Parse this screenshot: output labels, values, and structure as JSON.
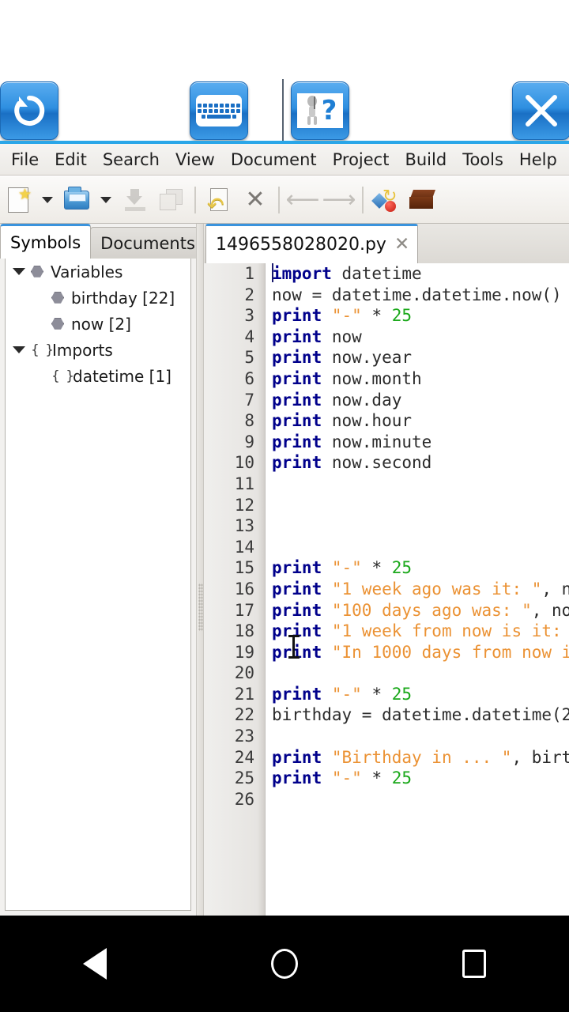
{
  "window": {
    "action_buttons": [
      {
        "name": "rotate-screen-button",
        "icon": "rotate-icon",
        "label": "Rotate"
      },
      {
        "name": "keyboard-toggle-button",
        "icon": "keyboard-icon",
        "label": "Keyboard"
      },
      {
        "name": "help-button",
        "icon": "help-question-icon",
        "label": "Help"
      },
      {
        "name": "close-button",
        "icon": "close-x-icon",
        "label": "Close"
      }
    ]
  },
  "menubar": {
    "items": [
      "File",
      "Edit",
      "Search",
      "View",
      "Document",
      "Project",
      "Build",
      "Tools",
      "Help"
    ]
  },
  "toolbar": {
    "items": [
      {
        "name": "new-document-button",
        "icon": "new-document-icon"
      },
      {
        "name": "new-document-dropdown",
        "icon": "chevron-down-icon"
      },
      {
        "name": "open-file-button",
        "icon": "open-folder-icon"
      },
      {
        "name": "open-file-dropdown",
        "icon": "chevron-down-icon"
      },
      {
        "name": "save-button",
        "icon": "save-icon"
      },
      {
        "name": "save-all-button",
        "icon": "save-all-icon"
      },
      {
        "name": "revert-button",
        "icon": "revert-document-icon"
      },
      {
        "name": "close-document-button",
        "icon": "close-x-icon"
      },
      {
        "name": "navigate-back-button",
        "icon": "arrow-left-icon"
      },
      {
        "name": "navigate-forward-button",
        "icon": "arrow-right-icon"
      },
      {
        "name": "compile-button",
        "icon": "compile-icon"
      },
      {
        "name": "build-button",
        "icon": "brick-build-icon"
      }
    ]
  },
  "sidebar": {
    "tabs": [
      {
        "label": "Symbols",
        "active": true
      },
      {
        "label": "Documents",
        "active": false
      }
    ],
    "tree": [
      {
        "label": "Variables",
        "level": 0,
        "expanded": true,
        "icon": "variable-hex-icon"
      },
      {
        "label": "birthday [22]",
        "level": 1,
        "expanded": null,
        "icon": "variable-hex-icon"
      },
      {
        "label": "now [2]",
        "level": 1,
        "expanded": null,
        "icon": "variable-hex-icon"
      },
      {
        "label": "Imports",
        "level": 0,
        "expanded": true,
        "icon": "import-brace-icon",
        "brace": "{ }"
      },
      {
        "label": "datetime [1]",
        "level": 1,
        "expanded": null,
        "icon": "import-brace-icon",
        "brace": "{ }"
      }
    ]
  },
  "editor": {
    "tab": {
      "filename": "1496558028020.py",
      "close_label": "✕"
    },
    "lines": [
      {
        "num": "1",
        "tokens": [
          {
            "t": "import",
            "c": "k"
          },
          {
            "t": " datetime",
            "c": "o"
          }
        ]
      },
      {
        "num": "2",
        "tokens": [
          {
            "t": "now = datetime.datetime.now()",
            "c": "o"
          }
        ]
      },
      {
        "num": "3",
        "tokens": [
          {
            "t": "print",
            "c": "k"
          },
          {
            "t": " ",
            "c": "o"
          },
          {
            "t": "\"-\"",
            "c": "s"
          },
          {
            "t": " * ",
            "c": "o"
          },
          {
            "t": "25",
            "c": "n"
          }
        ]
      },
      {
        "num": "4",
        "tokens": [
          {
            "t": "print",
            "c": "k"
          },
          {
            "t": " now",
            "c": "o"
          }
        ]
      },
      {
        "num": "5",
        "tokens": [
          {
            "t": "print",
            "c": "k"
          },
          {
            "t": " now.year",
            "c": "o"
          }
        ]
      },
      {
        "num": "6",
        "tokens": [
          {
            "t": "print",
            "c": "k"
          },
          {
            "t": " now.month",
            "c": "o"
          }
        ]
      },
      {
        "num": "7",
        "tokens": [
          {
            "t": "print",
            "c": "k"
          },
          {
            "t": " now.day",
            "c": "o"
          }
        ]
      },
      {
        "num": "8",
        "tokens": [
          {
            "t": "print",
            "c": "k"
          },
          {
            "t": " now.hour",
            "c": "o"
          }
        ]
      },
      {
        "num": "9",
        "tokens": [
          {
            "t": "print",
            "c": "k"
          },
          {
            "t": " now.minute",
            "c": "o"
          }
        ]
      },
      {
        "num": "10",
        "tokens": [
          {
            "t": "print",
            "c": "k"
          },
          {
            "t": " now.second",
            "c": "o"
          }
        ]
      },
      {
        "num": "11",
        "tokens": []
      },
      {
        "num": "12",
        "tokens": []
      },
      {
        "num": "13",
        "tokens": []
      },
      {
        "num": "14",
        "tokens": []
      },
      {
        "num": "15",
        "tokens": [
          {
            "t": "print",
            "c": "k"
          },
          {
            "t": " ",
            "c": "o"
          },
          {
            "t": "\"-\"",
            "c": "s"
          },
          {
            "t": " * ",
            "c": "o"
          },
          {
            "t": "25",
            "c": "n"
          }
        ]
      },
      {
        "num": "16",
        "tokens": [
          {
            "t": "print",
            "c": "k"
          },
          {
            "t": " ",
            "c": "o"
          },
          {
            "t": "\"1 week ago was it: \"",
            "c": "s"
          },
          {
            "t": ", no",
            "c": "o"
          }
        ]
      },
      {
        "num": "17",
        "tokens": [
          {
            "t": "print",
            "c": "k"
          },
          {
            "t": " ",
            "c": "o"
          },
          {
            "t": "\"100 days ago was: \"",
            "c": "s"
          },
          {
            "t": ", now",
            "c": "o"
          }
        ]
      },
      {
        "num": "18",
        "tokens": [
          {
            "t": "print",
            "c": "k"
          },
          {
            "t": " ",
            "c": "o"
          },
          {
            "t": "\"1 week from now is it: ",
            "c": "s"
          }
        ]
      },
      {
        "num": "19",
        "tokens": [
          {
            "t": "print",
            "c": "k"
          },
          {
            "t": " ",
            "c": "o"
          },
          {
            "t": "\"In 1000 days from now i",
            "c": "s"
          }
        ]
      },
      {
        "num": "20",
        "tokens": []
      },
      {
        "num": "21",
        "tokens": [
          {
            "t": "print",
            "c": "k"
          },
          {
            "t": " ",
            "c": "o"
          },
          {
            "t": "\"-\"",
            "c": "s"
          },
          {
            "t": " * ",
            "c": "o"
          },
          {
            "t": "25",
            "c": "n"
          }
        ]
      },
      {
        "num": "22",
        "tokens": [
          {
            "t": "birthday = datetime.datetime(2",
            "c": "o"
          }
        ]
      },
      {
        "num": "23",
        "tokens": []
      },
      {
        "num": "24",
        "tokens": [
          {
            "t": "print",
            "c": "k"
          },
          {
            "t": " ",
            "c": "o"
          },
          {
            "t": "\"Birthday in ... \"",
            "c": "s"
          },
          {
            "t": ", birt",
            "c": "o"
          }
        ]
      },
      {
        "num": "25",
        "tokens": [
          {
            "t": "print",
            "c": "k"
          },
          {
            "t": " ",
            "c": "o"
          },
          {
            "t": "\"-\"",
            "c": "s"
          },
          {
            "t": " * ",
            "c": "o"
          },
          {
            "t": "25",
            "c": "n"
          }
        ]
      },
      {
        "num": "26",
        "tokens": []
      }
    ]
  },
  "navbar": {
    "buttons": [
      {
        "name": "android-back-button",
        "icon": "triangle-left-icon"
      },
      {
        "name": "android-home-button",
        "icon": "circle-icon"
      },
      {
        "name": "android-recents-button",
        "icon": "square-icon"
      }
    ]
  },
  "colors": {
    "accent_blue": "#2aa6e8",
    "keyword": "#00008b",
    "string": "#eb9234",
    "number": "#1aa81a",
    "plain": "#2b2b2b"
  }
}
